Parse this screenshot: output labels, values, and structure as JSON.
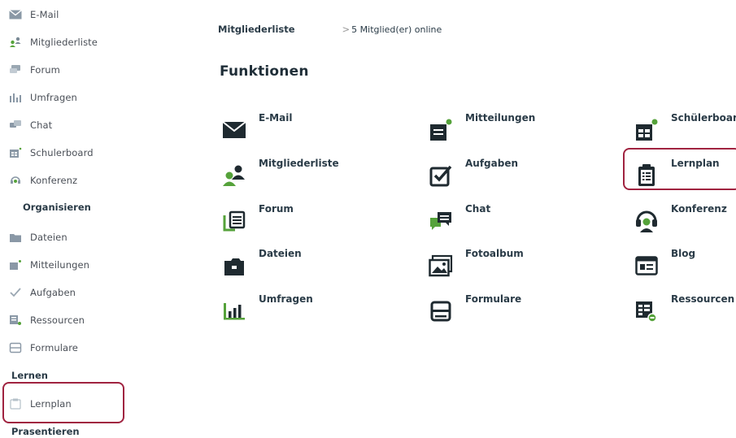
{
  "sidebar": {
    "items": [
      {
        "label": "E-Mail",
        "icon": "envelope-icon"
      },
      {
        "label": "Mitgliederliste",
        "icon": "members-icon"
      },
      {
        "label": "Forum",
        "icon": "forum-icon"
      },
      {
        "label": "Umfragen",
        "icon": "poll-chart-icon"
      },
      {
        "label": "Chat",
        "icon": "chat-bubbles-icon"
      },
      {
        "label": "Schulerboard",
        "icon": "board-icon"
      },
      {
        "label": "Konferenz",
        "icon": "headset-icon"
      }
    ],
    "section_organisieren": "Organisieren",
    "organisieren_items": [
      {
        "label": "Dateien",
        "icon": "folder-icon"
      },
      {
        "label": "Mitteilungen",
        "icon": "message-icon"
      },
      {
        "label": "Aufgaben",
        "icon": "checkbox-icon"
      },
      {
        "label": "Ressourcen",
        "icon": "resources-icon"
      },
      {
        "label": "Formulare",
        "icon": "form-icon"
      }
    ],
    "section_lernen": "Lernen",
    "lernen_items": [
      {
        "label": "Lernplan",
        "icon": "clipboard-icon"
      }
    ],
    "section_praesentieren": "Prasentieren"
  },
  "breadcrumb": {
    "title": "Mitgliederliste",
    "separator": ">",
    "online": "5 Mitglied(er) online"
  },
  "main": {
    "title": "Funktionen",
    "functions": [
      {
        "label": "E-Mail",
        "icon": "envelope-icon"
      },
      {
        "label": "Mitteilungen",
        "icon": "message-icon"
      },
      {
        "label": "Schülerboard",
        "icon": "board-icon"
      },
      {
        "label": "Mitgliederliste",
        "icon": "members-icon"
      },
      {
        "label": "Aufgaben",
        "icon": "checkbox-icon"
      },
      {
        "label": "Lernplan",
        "icon": "clipboard-icon"
      },
      {
        "label": "Forum",
        "icon": "forum-icon"
      },
      {
        "label": "Chat",
        "icon": "chat-bubbles-icon"
      },
      {
        "label": "Konferenz",
        "icon": "headset-icon"
      },
      {
        "label": "Dateien",
        "icon": "folder-icon"
      },
      {
        "label": "Fotoalbum",
        "icon": "photo-album-icon"
      },
      {
        "label": "Blog",
        "icon": "blog-icon"
      },
      {
        "label": "Umfragen",
        "icon": "poll-chart-icon"
      },
      {
        "label": "Formulare",
        "icon": "form-icon"
      },
      {
        "label": "Ressourcen",
        "icon": "resources-icon"
      }
    ]
  },
  "colors": {
    "icon_dark": "#1f2a30",
    "icon_green": "#55a23a",
    "highlight": "#a02340",
    "sidebar_icon": "#8a98a6"
  }
}
